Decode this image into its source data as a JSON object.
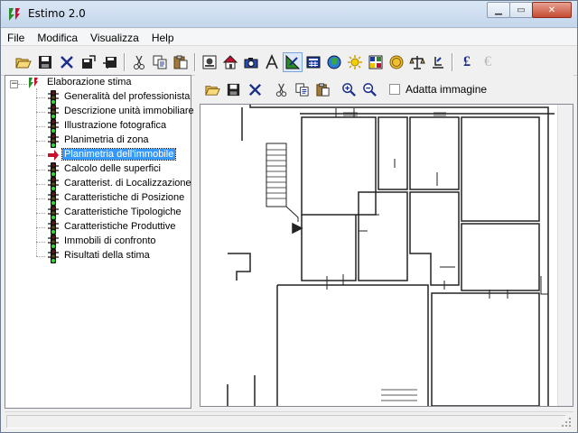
{
  "window": {
    "title": "Estimo 2.0"
  },
  "menu": [
    "File",
    "Modifica",
    "Visualizza",
    "Help"
  ],
  "toolbar": {
    "icons": [
      "open-folder-icon",
      "save-icon",
      "delete-icon",
      "export-icon",
      "import-icon",
      "cut-icon",
      "copy-icon",
      "paste-icon",
      "report-icon",
      "home-icon",
      "camera-icon",
      "text-icon",
      "drawing-icon",
      "calculator-icon",
      "globe-icon",
      "sun-icon",
      "grid-icon",
      "coin-icon",
      "scale-icon",
      "hand-icon",
      "pound-icon",
      "euro-icon"
    ],
    "pound_glyph": "£",
    "euro_glyph": "€"
  },
  "tree": {
    "root": "Elaborazione stima",
    "items": [
      "Generalità del professionista",
      "Descrizione unità immobiliare",
      "Illustrazione fotografica",
      "Planimetria di zona",
      "Planimetria dell'immobile",
      "Calcolo delle superfici",
      "Caratterist. di Localizzazione",
      "Caratteristiche di Posizione",
      "Caratteristiche Tipologiche",
      "Caratteristiche Produttive",
      "Immobili di confronto",
      "Risultati della stima"
    ],
    "selected_index": 4
  },
  "image_panel": {
    "fit_label": "Adatta immagine",
    "fit_checked": false
  },
  "colors": {
    "selection": "#3399ff",
    "accent_red": "#c8102e",
    "traffic_green": "#1e8c1e"
  }
}
